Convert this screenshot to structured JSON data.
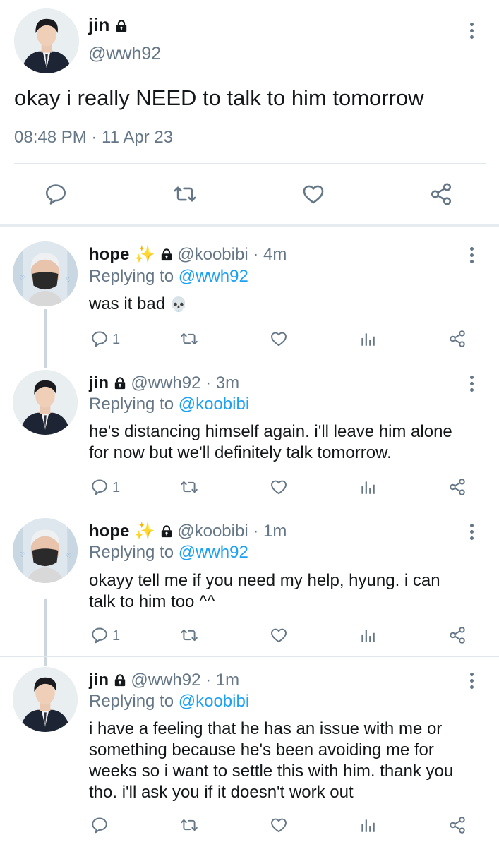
{
  "main_tweet": {
    "display_name": "jin",
    "handle": "@wwh92",
    "text": "okay i really NEED to talk to him tomorrow",
    "timestamp": "08:48 PM · 11 Apr 23"
  },
  "replies": [
    {
      "display_name": "hope",
      "name_emoji": "✨",
      "handle": "@koobibi",
      "time": "· 4m",
      "replying_prefix": "Replying to",
      "replying_to": "@wwh92",
      "text": "was it bad",
      "text_emoji": "💀",
      "reply_count": "1"
    },
    {
      "display_name": "jin",
      "name_emoji": "",
      "handle": "@wwh92",
      "time": "· 3m",
      "replying_prefix": "Replying to",
      "replying_to": "@koobibi",
      "text_lines": [
        "he's distancing himself again. i'll leave him alone",
        "for now but we'll definitely talk tomorrow."
      ],
      "reply_count": "1"
    },
    {
      "display_name": "hope",
      "name_emoji": "✨",
      "handle": "@koobibi",
      "time": "· 1m",
      "replying_prefix": "Replying to",
      "replying_to": "@wwh92",
      "text_lines": [
        "okayy tell me if you need my help, hyung. i can",
        "talk to him too ^^"
      ],
      "reply_count": "1"
    },
    {
      "display_name": "jin",
      "name_emoji": "",
      "handle": "@wwh92",
      "time": "· 1m",
      "replying_prefix": "Replying to",
      "replying_to": "@koobibi",
      "text_lines": [
        "i have a feeling that he has an issue with me or",
        "something because he's been avoiding me for",
        "weeks so i want to settle this with him. thank you",
        "tho. i'll ask you if it doesn't work out"
      ],
      "reply_count": ""
    }
  ],
  "icons": {
    "reply": "reply-icon",
    "retweet": "retweet-icon",
    "like": "heart-icon",
    "analytics": "analytics-icon",
    "share": "share-icon",
    "lock": "lock-icon",
    "more": "more-icon"
  },
  "colors": {
    "link": "#1da1f2",
    "secondary_text": "#657786",
    "divider": "#e1e8ed"
  }
}
